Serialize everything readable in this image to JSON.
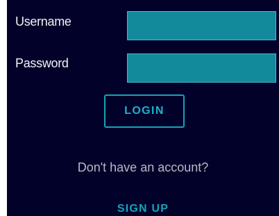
{
  "form": {
    "username_label": "Username",
    "username_value": "",
    "password_label": "Password",
    "password_value": "",
    "login_label": "LOGIN"
  },
  "footer": {
    "prompt": "Don't have an account?",
    "signup_label": "SIGN UP"
  },
  "colors": {
    "background": "#02012a",
    "field_fill": "#138a9c",
    "accent": "#17a3b8",
    "label_text": "#f2f2f2",
    "muted_text": "#b9b9c4"
  }
}
